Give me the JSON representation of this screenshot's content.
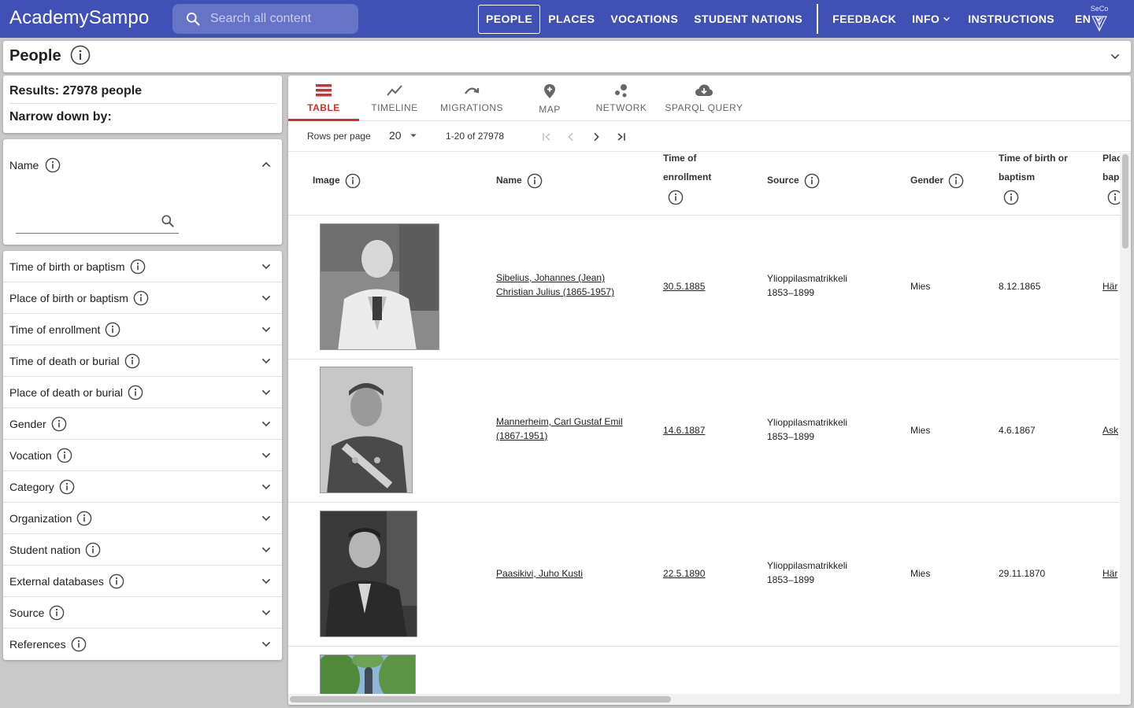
{
  "app": {
    "title": "AcademySampo"
  },
  "search": {
    "placeholder": "Search all content"
  },
  "nav": {
    "items": [
      "PEOPLE",
      "PLACES",
      "VOCATIONS",
      "STUDENT NATIONS"
    ],
    "feedback": "FEEDBACK",
    "info": "INFO",
    "instructions": "INSTRUCTIONS",
    "language": "EN",
    "seco": "SeCo"
  },
  "page": {
    "title": "People"
  },
  "sidebar": {
    "results": "Results: 27978 people",
    "narrow": "Narrow down by:",
    "name_facet": "Name",
    "facets": [
      "Time of birth or baptism",
      "Place of birth or baptism",
      "Time of enrollment",
      "Time of death or burial",
      "Place of death or burial",
      "Gender",
      "Vocation",
      "Category",
      "Organization",
      "Student nation",
      "External databases",
      "Source",
      "References"
    ]
  },
  "tabs": [
    "TABLE",
    "TIMELINE",
    "MIGRATIONS",
    "MAP",
    "NETWORK",
    "SPARQL QUERY"
  ],
  "pager": {
    "rows_label": "Rows per page",
    "rows_value": "20",
    "range": "1-20 of 27978"
  },
  "table": {
    "headers": {
      "image": "Image",
      "name": "Name",
      "enroll_1": "Time of",
      "enroll_2": "enrollment",
      "source": "Source",
      "gender": "Gender",
      "birth_1": "Time of birth or",
      "birth_2": "baptism",
      "place_1": "Plac",
      "place_2": "bap"
    },
    "rows": [
      {
        "name_1": "Sibelius, Johannes (Jean)",
        "name_2": "Christian Julius (1865-1957)",
        "enroll": "30.5.1885",
        "source_1": "Ylioppilasmatrikkeli",
        "source_2": "1853–1899",
        "gender": "Mies",
        "birth": "8.12.1865",
        "place": "Här"
      },
      {
        "name_1": "Mannerheim, Carl Gustaf Emil",
        "name_2": "(1867-1951)",
        "enroll": "14.6.1887",
        "source_1": "Ylioppilasmatrikkeli",
        "source_2": "1853–1899",
        "gender": "Mies",
        "birth": "4.6.1867",
        "place": "Ask"
      },
      {
        "name_1": "Paasikivi, Juho Kusti",
        "name_2": "",
        "enroll": "22.5.1890",
        "source_1": "Ylioppilasmatrikkeli",
        "source_2": "1853–1899",
        "gender": "Mies",
        "birth": "29.11.1870",
        "place": "Här"
      }
    ]
  }
}
